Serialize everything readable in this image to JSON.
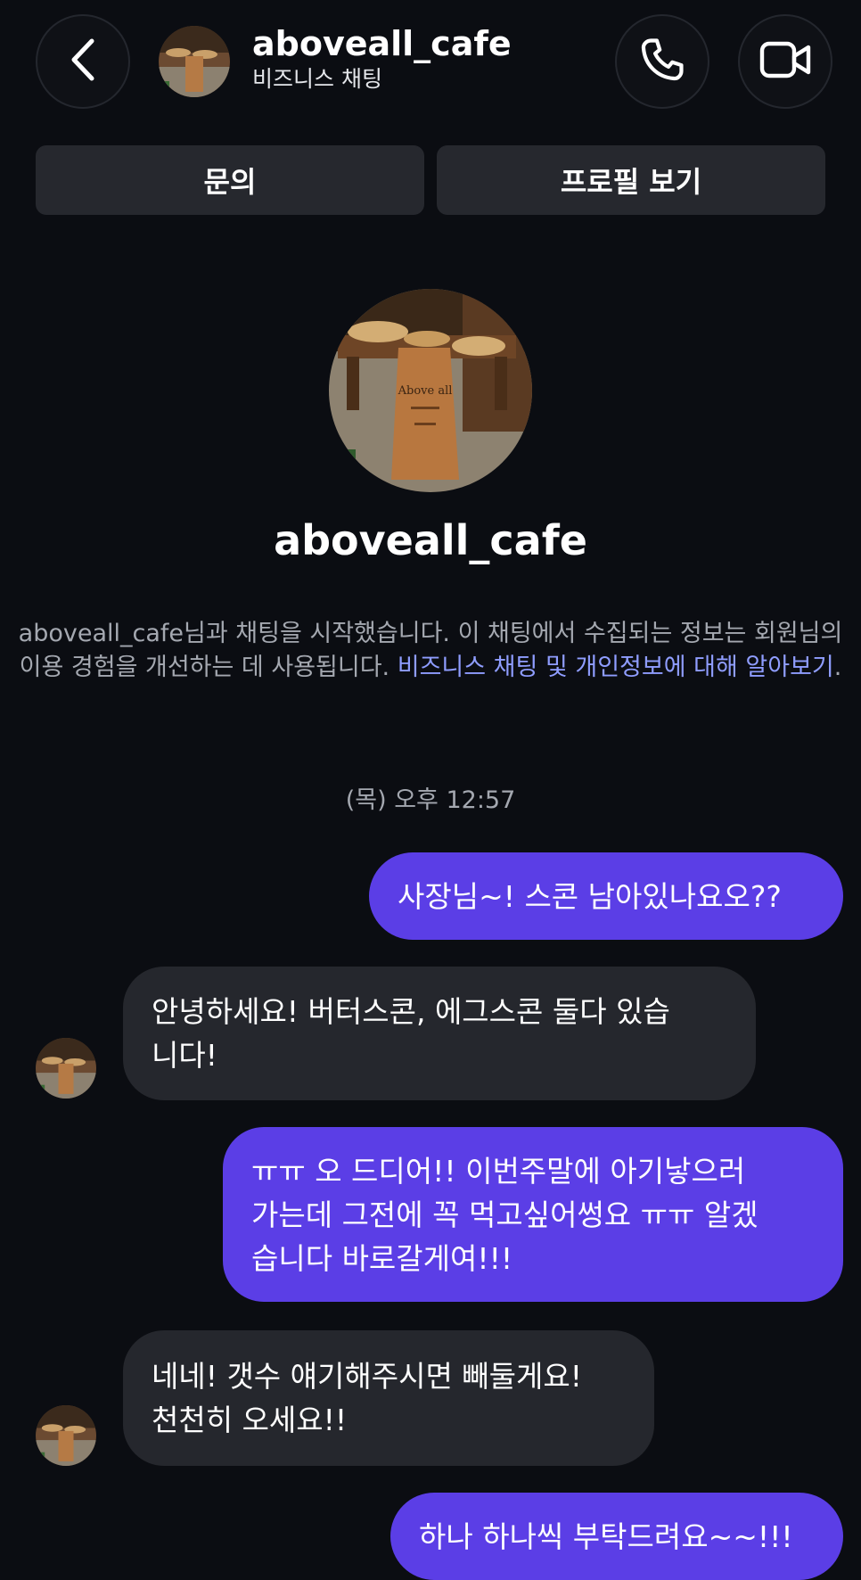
{
  "header": {
    "title": "aboveall_cafe",
    "subtitle": "비즈니스 채팅",
    "back_icon": "chevron-left-icon",
    "call_icon": "phone-icon",
    "video_icon": "video-camera-icon"
  },
  "actions": {
    "inquiry": "문의",
    "view_profile": "프로필 보기"
  },
  "profile": {
    "name": "aboveall_cafe",
    "sign_text": "Above all"
  },
  "intro": {
    "text": "aboveall_cafe님과 채팅을 시작했습니다. 이 채팅에서 수집되는 정보는 회원님의 이용 경험을 개선하는 데 사용됩니다. ",
    "link": "비즈니스 채팅 및 개인정보에 대해 알아보기",
    "end": "."
  },
  "timestamp": "(목) 오후 12:57",
  "messages": [
    {
      "direction": "out",
      "text": "사장님~! 스콘 남아있나요오??"
    },
    {
      "direction": "in",
      "text": "안녕하세요! 버터스콘, 에그스콘 둘다 있습\n니다!"
    },
    {
      "direction": "out",
      "text": "ㅠㅠ 오 드디어!! 이번주말에 아기낳으러\n가는데 그전에 꼭 먹고싶어썽요 ㅠㅠ 알겠\n습니다 바로갈게여!!!"
    },
    {
      "direction": "in",
      "text": "네네! 갯수 얘기해주시면 빼둘게요!\n천천히 오세요!!"
    },
    {
      "direction": "out",
      "text": "하나 하나씩 부탁드려요~~!!!"
    }
  ],
  "colors": {
    "background": "#0b0d12",
    "outgoing_bubble": "#5b3ee6",
    "incoming_bubble": "#25272d",
    "link": "#8f9dff"
  }
}
